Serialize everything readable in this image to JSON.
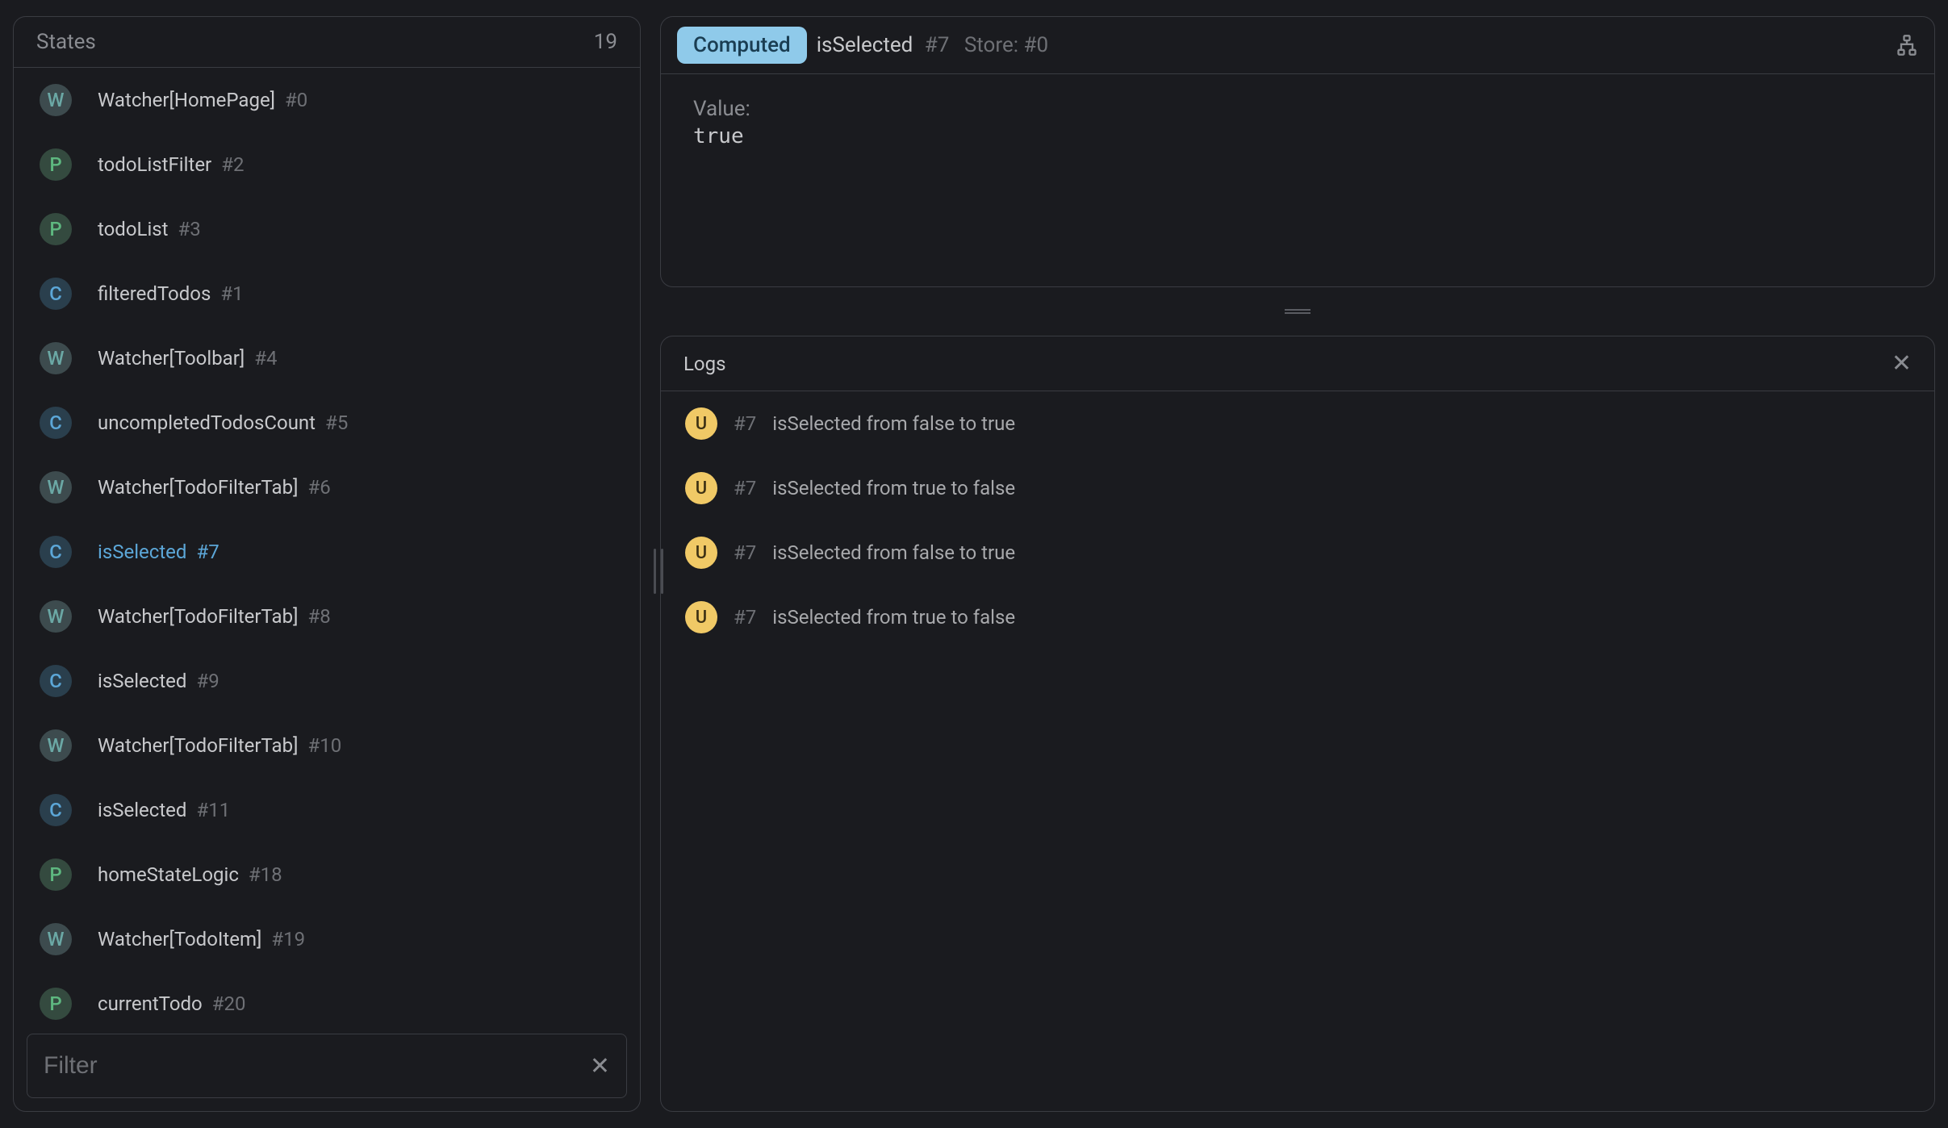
{
  "states_panel": {
    "title": "States",
    "count": "19",
    "filter_placeholder": "Filter"
  },
  "states": [
    {
      "badge": "W",
      "badge_class": "badge-w",
      "name": "Watcher[HomePage]",
      "id": "#0",
      "selected": false
    },
    {
      "badge": "P",
      "badge_class": "badge-p",
      "name": "todoListFilter",
      "id": "#2",
      "selected": false
    },
    {
      "badge": "P",
      "badge_class": "badge-p",
      "name": "todoList",
      "id": "#3",
      "selected": false
    },
    {
      "badge": "C",
      "badge_class": "badge-c",
      "name": "filteredTodos",
      "id": "#1",
      "selected": false
    },
    {
      "badge": "W",
      "badge_class": "badge-w",
      "name": "Watcher[Toolbar]",
      "id": "#4",
      "selected": false
    },
    {
      "badge": "C",
      "badge_class": "badge-c",
      "name": "uncompletedTodosCount",
      "id": "#5",
      "selected": false
    },
    {
      "badge": "W",
      "badge_class": "badge-w",
      "name": "Watcher[TodoFilterTab]",
      "id": "#6",
      "selected": false
    },
    {
      "badge": "C",
      "badge_class": "badge-c",
      "name": "isSelected",
      "id": "#7",
      "selected": true
    },
    {
      "badge": "W",
      "badge_class": "badge-w",
      "name": "Watcher[TodoFilterTab]",
      "id": "#8",
      "selected": false
    },
    {
      "badge": "C",
      "badge_class": "badge-c",
      "name": "isSelected",
      "id": "#9",
      "selected": false
    },
    {
      "badge": "W",
      "badge_class": "badge-w",
      "name": "Watcher[TodoFilterTab]",
      "id": "#10",
      "selected": false
    },
    {
      "badge": "C",
      "badge_class": "badge-c",
      "name": "isSelected",
      "id": "#11",
      "selected": false
    },
    {
      "badge": "P",
      "badge_class": "badge-p",
      "name": "homeStateLogic",
      "id": "#18",
      "selected": false
    },
    {
      "badge": "W",
      "badge_class": "badge-w",
      "name": "Watcher[TodoItem]",
      "id": "#19",
      "selected": false
    },
    {
      "badge": "P",
      "badge_class": "badge-p",
      "name": "currentTodo",
      "id": "#20",
      "selected": false
    }
  ],
  "detail": {
    "tag": "Computed",
    "name": "isSelected",
    "id": "#7",
    "store_label": "Store:",
    "store_id": "#0",
    "value_label": "Value:",
    "value": "true"
  },
  "logs_panel": {
    "title": "Logs"
  },
  "logs": [
    {
      "badge": "U",
      "id": "#7",
      "msg": "isSelected from false to true"
    },
    {
      "badge": "U",
      "id": "#7",
      "msg": "isSelected from true to false"
    },
    {
      "badge": "U",
      "id": "#7",
      "msg": "isSelected from false to true"
    },
    {
      "badge": "U",
      "id": "#7",
      "msg": "isSelected from true to false"
    }
  ]
}
